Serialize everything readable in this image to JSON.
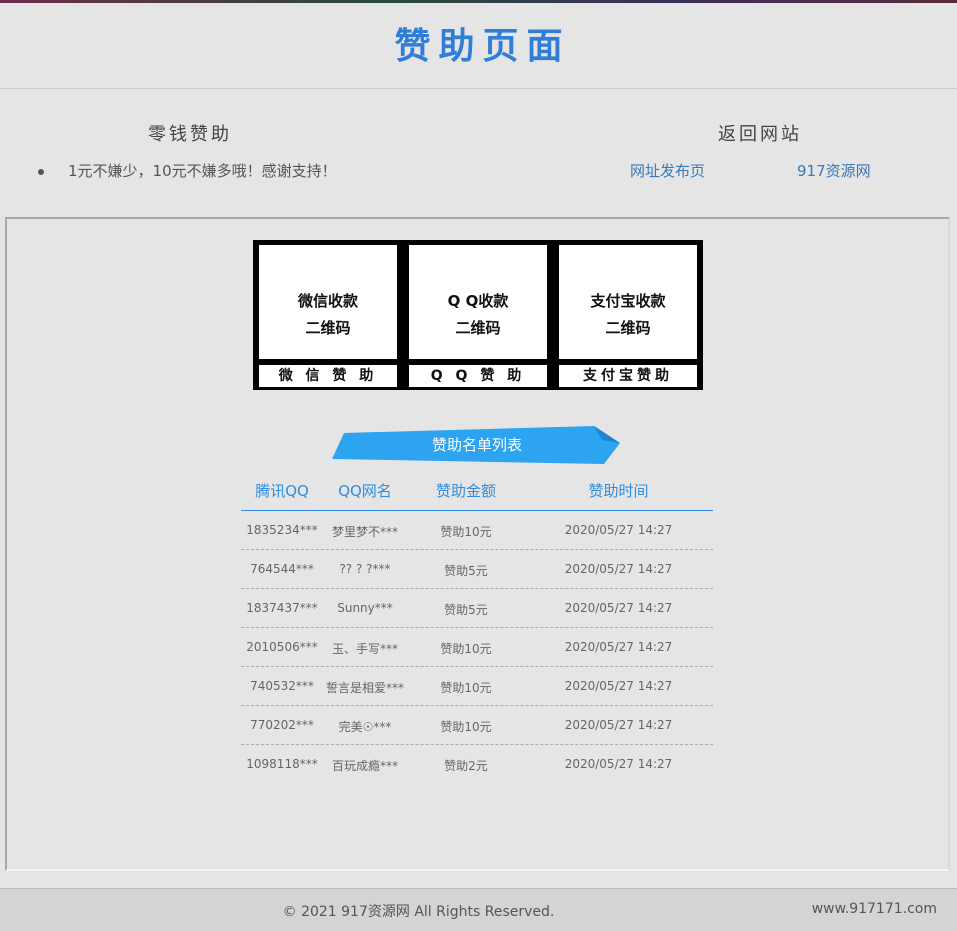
{
  "header": {
    "title": "赞助页面"
  },
  "left": {
    "title": "零钱赞助",
    "bullet": "1元不嫌少，10元不嫌多哦！感谢支持！"
  },
  "right": {
    "title": "返回网站",
    "links": [
      "网址发布页",
      "917资源网"
    ]
  },
  "qr": [
    {
      "line1": "微信收款",
      "line2": "二维码",
      "label": "微 信 赞 助"
    },
    {
      "line1": "Q Q收款",
      "line2": "二维码",
      "label": "Q Q 赞 助"
    },
    {
      "line1": "支付宝收款",
      "line2": "二维码",
      "label": "支付宝赞助"
    }
  ],
  "ribbon": {
    "title": "赞助名单列表",
    "color": "#2da4ef"
  },
  "table": {
    "headers": [
      "腾讯QQ",
      "QQ网名",
      "赞助金额",
      "赞助时间"
    ],
    "rows": [
      [
        "1835234***",
        "梦里梦不***",
        "赞助10元",
        "2020/05/27 14:27"
      ],
      [
        "764544***",
        "?? ? ?***",
        "赞助5元",
        "2020/05/27 14:27"
      ],
      [
        "1837437***",
        "Sunny***",
        "赞助5元",
        "2020/05/27 14:27"
      ],
      [
        "2010506***",
        "玉、手写***",
        "赞助10元",
        "2020/05/27 14:27"
      ],
      [
        "740532***",
        "誓言是相爱***",
        "赞助10元",
        "2020/05/27 14:27"
      ],
      [
        "770202***",
        "完美☉***",
        "赞助10元",
        "2020/05/27 14:27"
      ],
      [
        "1098118***",
        "百玩成瘾***",
        "赞助2元",
        "2020/05/27 14:27"
      ]
    ]
  },
  "footer": {
    "copyright": "© 2021 917资源网 All Rights Reserved.",
    "site": "www.917171.com"
  }
}
